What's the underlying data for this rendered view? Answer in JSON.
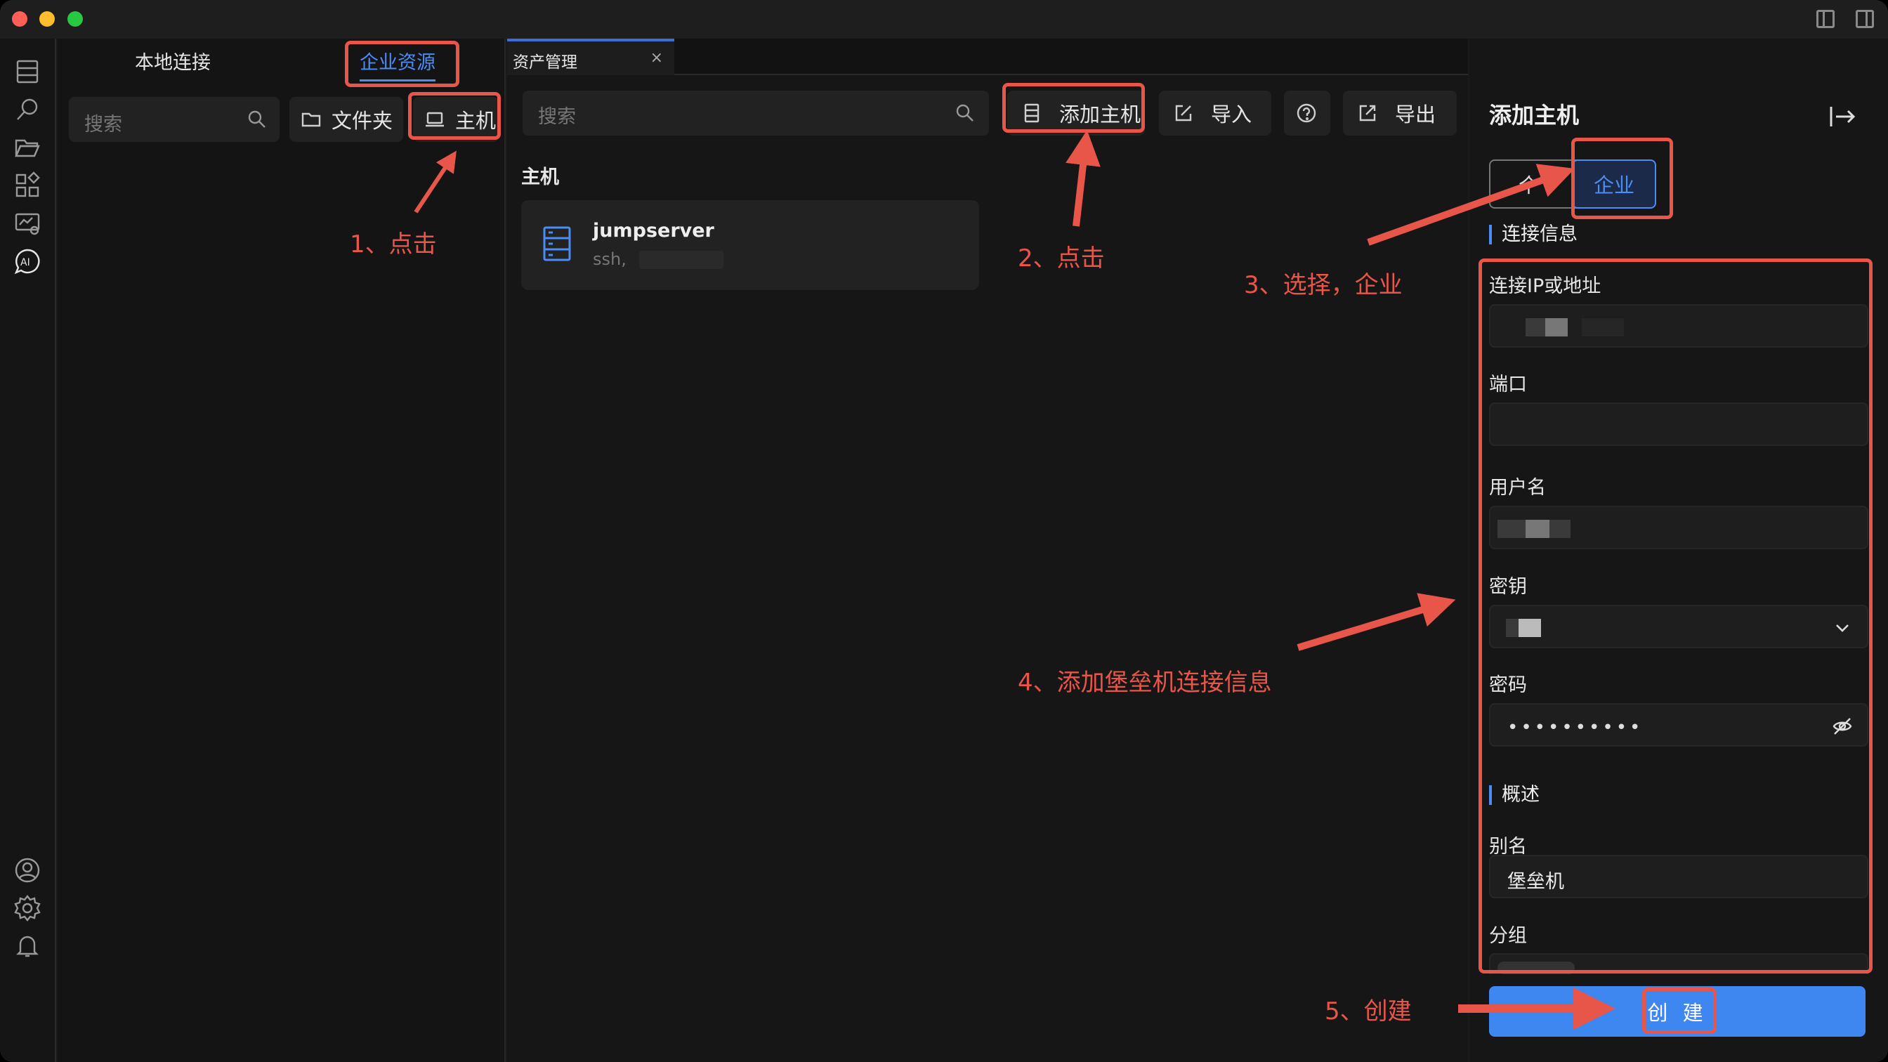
{
  "left_panel": {
    "tabs": {
      "local": "本地连接",
      "enterprise": "企业资源"
    },
    "search_placeholder": "搜索",
    "folder_button": "文件夹",
    "host_button": "主机"
  },
  "center": {
    "tab_title": "资产管理",
    "tab_close": "×",
    "search_placeholder": "搜索",
    "add_host": "添加主机",
    "import": "导入",
    "export": "导出",
    "section_title": "主机",
    "host_card": {
      "name": "jumpserver",
      "sub": "ssh,"
    }
  },
  "form": {
    "title": "添加主机",
    "segment_personal": "个",
    "segment_enterprise": "企业",
    "group_connection": "连接信息",
    "ip_label": "连接IP或地址",
    "port_label": "端口",
    "username_label": "用户名",
    "key_label": "密钥",
    "password_label": "密码",
    "password_mask": "••••••••••",
    "group_overview": "概述",
    "alias_label": "别名",
    "alias_value": "堡垒机",
    "group_label": "分组",
    "create_button": "创 建"
  },
  "annotations": {
    "step1": "1、点击",
    "step2": "2、点击",
    "step3": "3、选择，企业",
    "step4": "4、添加堡垒机连接信息",
    "step5": "5、创建"
  },
  "colors": {
    "accent": "#4c8cf5",
    "annotation": "#e8564a",
    "primary_button": "#3f87f0"
  }
}
